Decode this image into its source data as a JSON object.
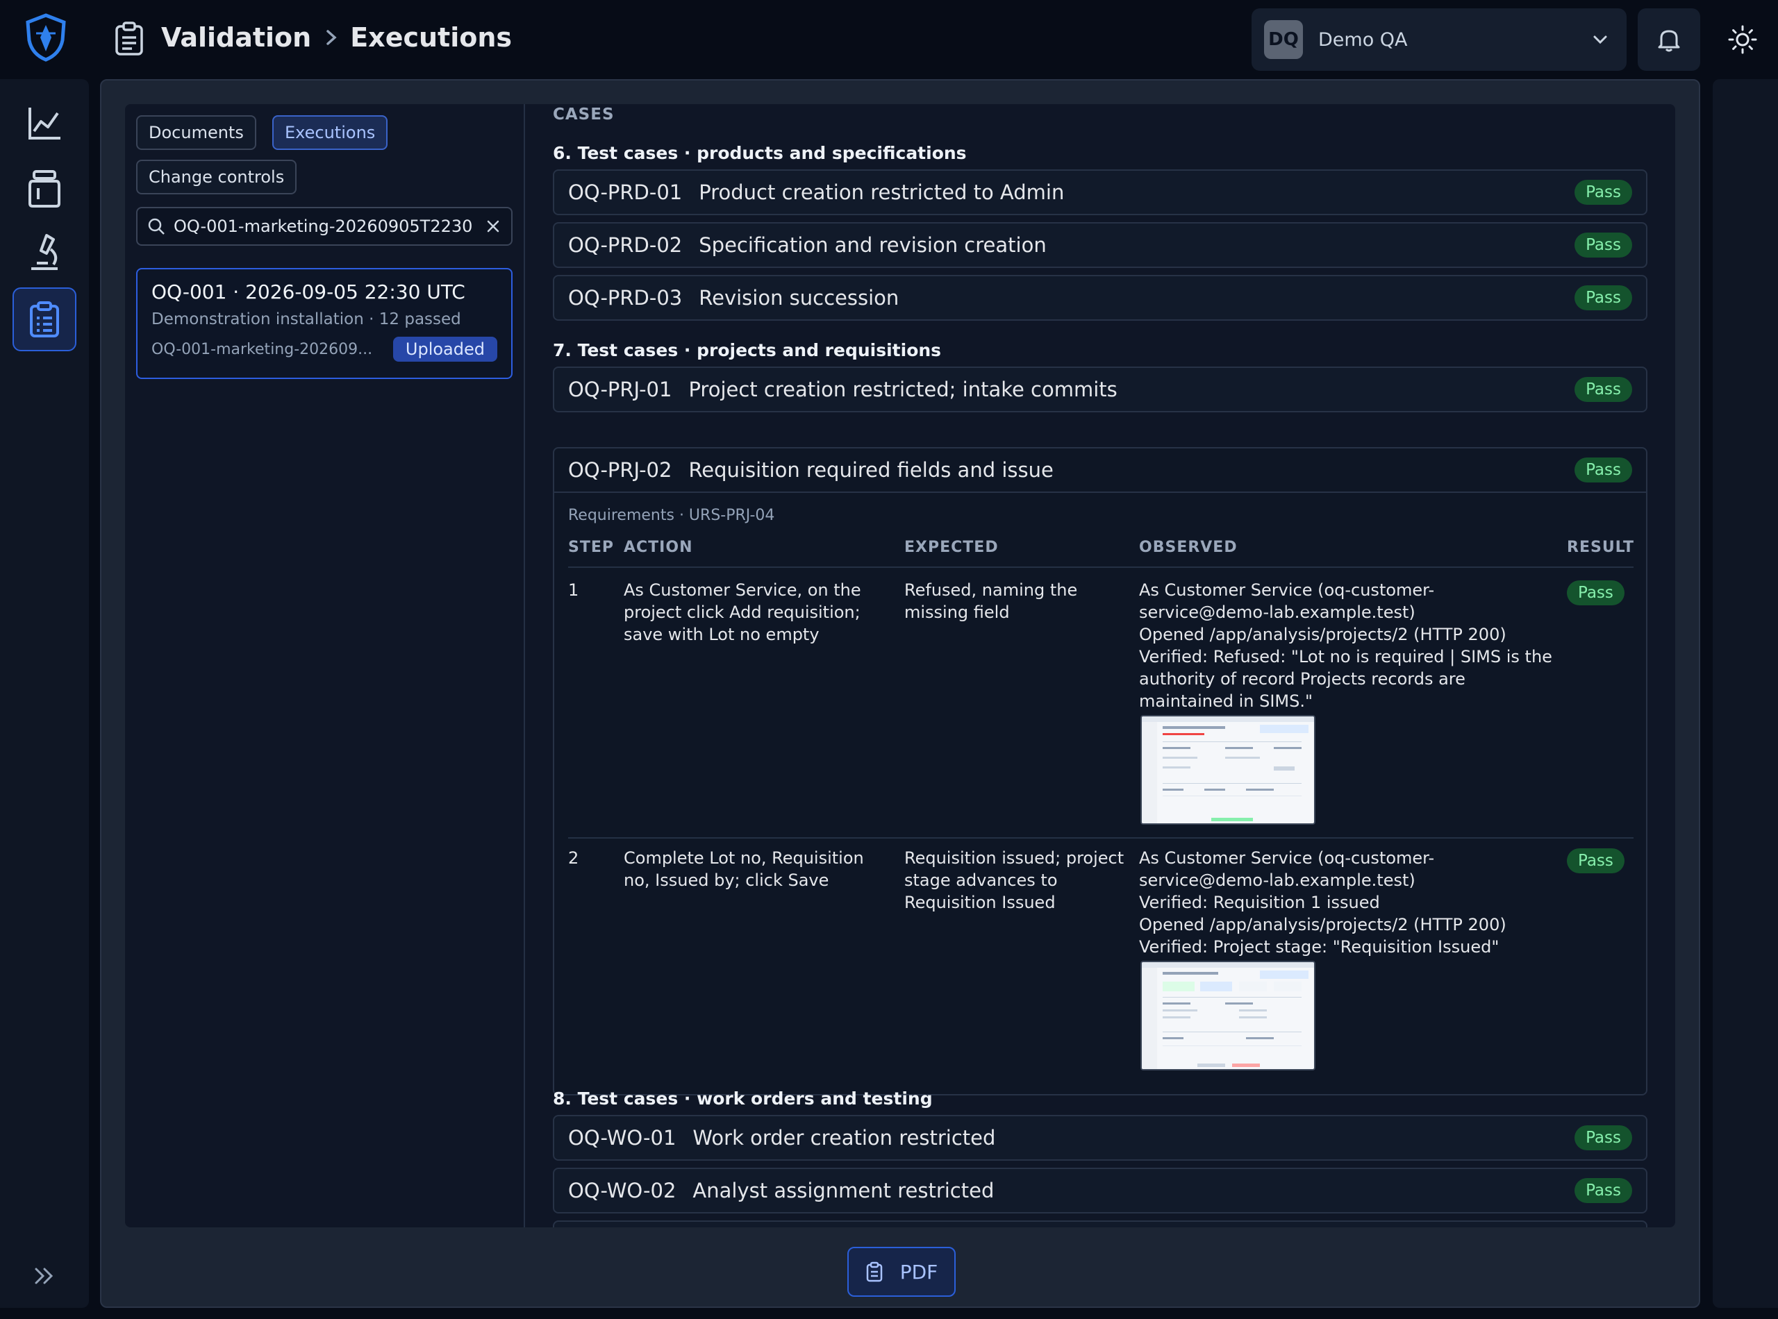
{
  "header": {
    "crumbs": [
      "Validation",
      "Executions"
    ],
    "user": {
      "initials": "DQ",
      "name": "Demo QA"
    }
  },
  "rail": {
    "items": [
      "chart-icon",
      "jar-icon",
      "microscope-icon",
      "clipboard-icon"
    ],
    "active_index": 3
  },
  "filters": {
    "documents": "Documents",
    "executions": "Executions",
    "change_controls": "Change controls",
    "active": "Executions"
  },
  "search": {
    "value": "OQ-001-marketing-20260905T2230"
  },
  "execution": {
    "title": "OQ-001 · 2026-09-05 22:30 UTC",
    "subtitle": "Demonstration installation · 12 passed",
    "file": "OQ-001-marketing-202609...",
    "status": "Uploaded"
  },
  "cases": {
    "label": "CASES",
    "sections": [
      {
        "heading": "6. Test cases · products and specifications",
        "cases": [
          {
            "id": "OQ-PRD-01",
            "title": "Product creation restricted to Admin",
            "result": "Pass"
          },
          {
            "id": "OQ-PRD-02",
            "title": "Specification and revision creation",
            "result": "Pass"
          },
          {
            "id": "OQ-PRD-03",
            "title": "Revision succession",
            "result": "Pass"
          }
        ]
      },
      {
        "heading": "7. Test cases · projects and requisitions",
        "cases": [
          {
            "id": "OQ-PRJ-01",
            "title": "Project creation restricted; intake commits",
            "result": "Pass"
          },
          {
            "id": "OQ-PRJ-02",
            "title": "Requisition required fields and issue",
            "result": "Pass"
          }
        ]
      },
      {
        "heading": "8. Test cases · work orders and testing",
        "cases": [
          {
            "id": "OQ-WO-01",
            "title": "Work order creation restricted",
            "result": "Pass"
          },
          {
            "id": "OQ-WO-02",
            "title": "Analyst assignment restricted",
            "result": "Pass"
          }
        ]
      }
    ],
    "expanded": {
      "requirements": "Requirements · URS-PRJ-04",
      "columns": [
        "STEP",
        "ACTION",
        "EXPECTED",
        "OBSERVED",
        "RESULT"
      ],
      "steps": [
        {
          "step": "1",
          "action": "As Customer Service, on the project click Add requisition; save with Lot no empty",
          "expected": "Refused, naming the missing field",
          "observed": "As Customer Service (oq-customer-service@demo-lab.example.test)\nOpened /app/analysis/projects/2 (HTTP 200)\nVerified: Refused: \"Lot no is required | SIMS is the authority of record Projects records are maintained in SIMS.\"",
          "result": "Pass"
        },
        {
          "step": "2",
          "action": "Complete Lot no, Requisition no, Issued by; click Save",
          "expected": "Requisition issued; project stage advances to Requisition Issued",
          "observed": "As Customer Service (oq-customer-service@demo-lab.example.test)\nVerified: Requisition 1 issued\nOpened /app/analysis/projects/2 (HTTP 200)\nVerified: Project stage: \"Requisition Issued\"",
          "result": "Pass"
        }
      ]
    }
  },
  "footer": {
    "pdf": "PDF"
  },
  "colors": {
    "accent": "#2b5fd9",
    "pass_bg": "#14532d",
    "pass_fg": "#86efac",
    "uploaded_bg": "#2747a8"
  }
}
